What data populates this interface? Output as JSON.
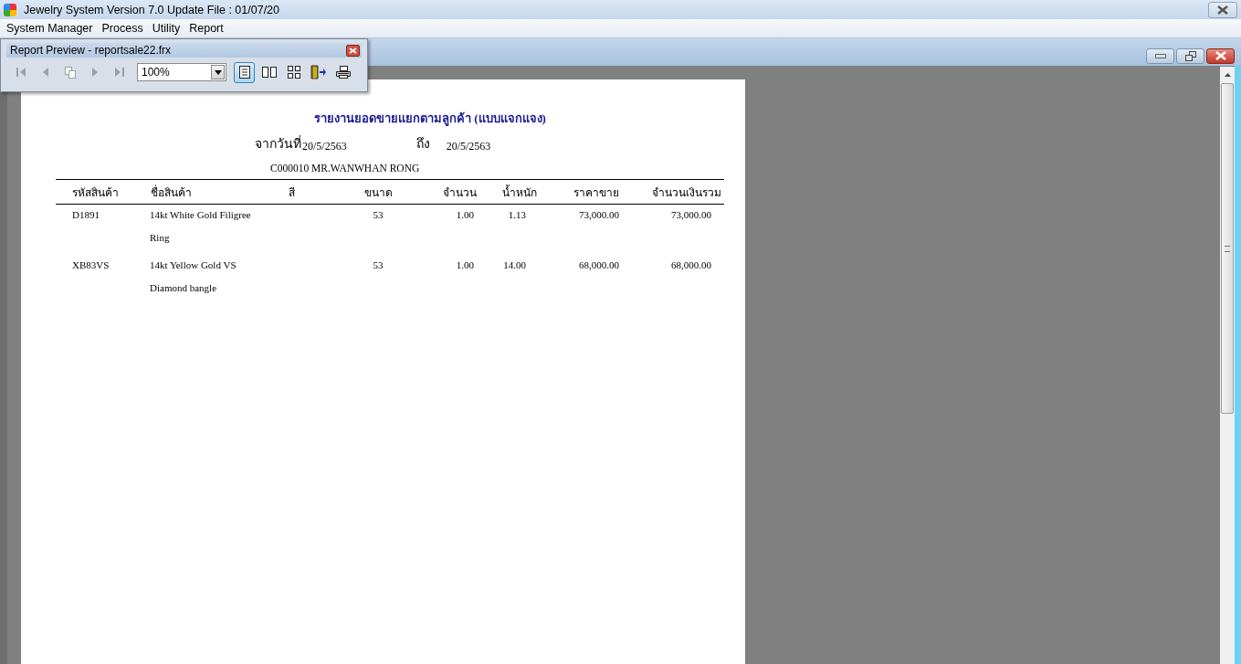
{
  "window": {
    "title": "Jewelry System Version 7.0 Update File : 01/07/20"
  },
  "menu": [
    "System Manager",
    "Process",
    "Utility",
    "Report"
  ],
  "preview_toolbar": {
    "title": "Report Preview - reportsale22.frx",
    "zoom": "100%",
    "tools": [
      {
        "kind": "first",
        "disabled": true
      },
      {
        "kind": "prev",
        "disabled": true
      },
      {
        "kind": "goto",
        "disabled": true
      },
      {
        "kind": "next",
        "disabled": true
      },
      {
        "kind": "last",
        "disabled": true
      },
      {
        "kind": "zoom"
      },
      {
        "kind": "one-page",
        "selected": true
      },
      {
        "kind": "two-pages",
        "selected": false
      },
      {
        "kind": "four-pages",
        "selected": false
      },
      {
        "kind": "close-preview"
      },
      {
        "kind": "print"
      }
    ]
  },
  "report": {
    "title": "รายงานยอดขายแยกตามลูกค้า (แบบแจกแจง)",
    "from_label": "จากวันที่",
    "from_date": "20/5/2563",
    "to_label": "ถึง",
    "to_date": "20/5/2563",
    "customer": "C000010 MR.WANWHAN  RONG",
    "columns": [
      "รหัสสินค้า",
      "ชื่อสินค้า",
      "สี",
      "ขนาด",
      "จำนวน",
      "น้ำหนัก",
      "ราคาขาย",
      "จำนวนเงินรวม"
    ],
    "rows": [
      {
        "code": "D1891",
        "name": [
          "14kt White Gold Filigree",
          "Ring"
        ],
        "size": "53",
        "qty": "1.00",
        "weight": "1.13",
        "price": "73,000.00",
        "total": "73,000.00"
      },
      {
        "code": "XB83VS",
        "name": [
          "14kt Yellow Gold VS",
          "Diamond bangle"
        ],
        "size": "53",
        "qty": "1.00",
        "weight": "14.00",
        "price": "68,000.00",
        "total": "68,000.00"
      }
    ]
  }
}
